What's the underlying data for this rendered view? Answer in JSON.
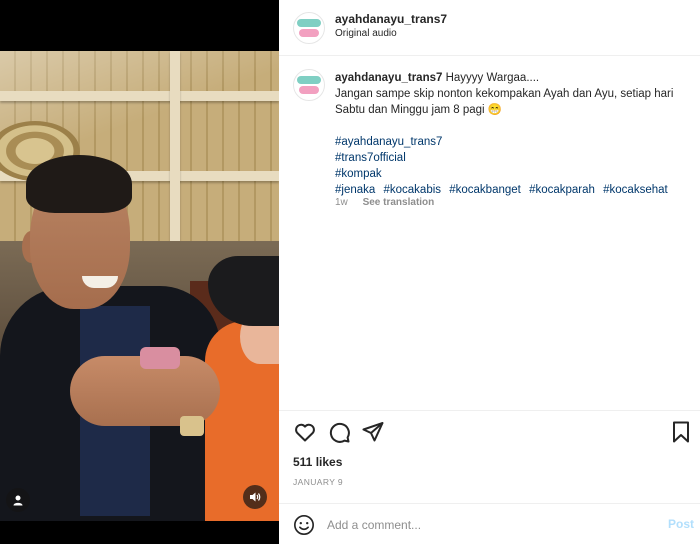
{
  "post": {
    "username": "ayahdanayu_trans7",
    "audio": "Original audio"
  },
  "caption": {
    "username": "ayahdanayu_trans7",
    "first_line": "Hayyyy Wargaa....",
    "body": "Jangan sampe skip nonton kekompakan Ayah dan Ayu, setiap hari Sabtu dan Minggu jam 8 pagi 😁",
    "hashtags": [
      "#ayahdanayu_trans7",
      "#trans7official",
      "#kompak"
    ],
    "hashtag_row": [
      "#jenaka",
      "#kocakabis",
      "#kocakbanget",
      "#kocakparah",
      "#kocaksehat"
    ],
    "age": "1w",
    "see_translation": "See translation"
  },
  "engagement": {
    "likes": "511 likes",
    "date": "JANUARY 9"
  },
  "comment": {
    "placeholder": "Add a comment...",
    "post_label": "Post"
  },
  "icons": {
    "like": "heart-icon",
    "comment": "comment-icon",
    "share": "share-icon",
    "save": "bookmark-icon",
    "emoji": "emoji-icon",
    "user_tag": "user-tag-icon",
    "audio": "speaker-icon"
  },
  "colors": {
    "link": "#00376b",
    "post_disabled": "#b2dffc",
    "muted": "#8e8e8e"
  }
}
